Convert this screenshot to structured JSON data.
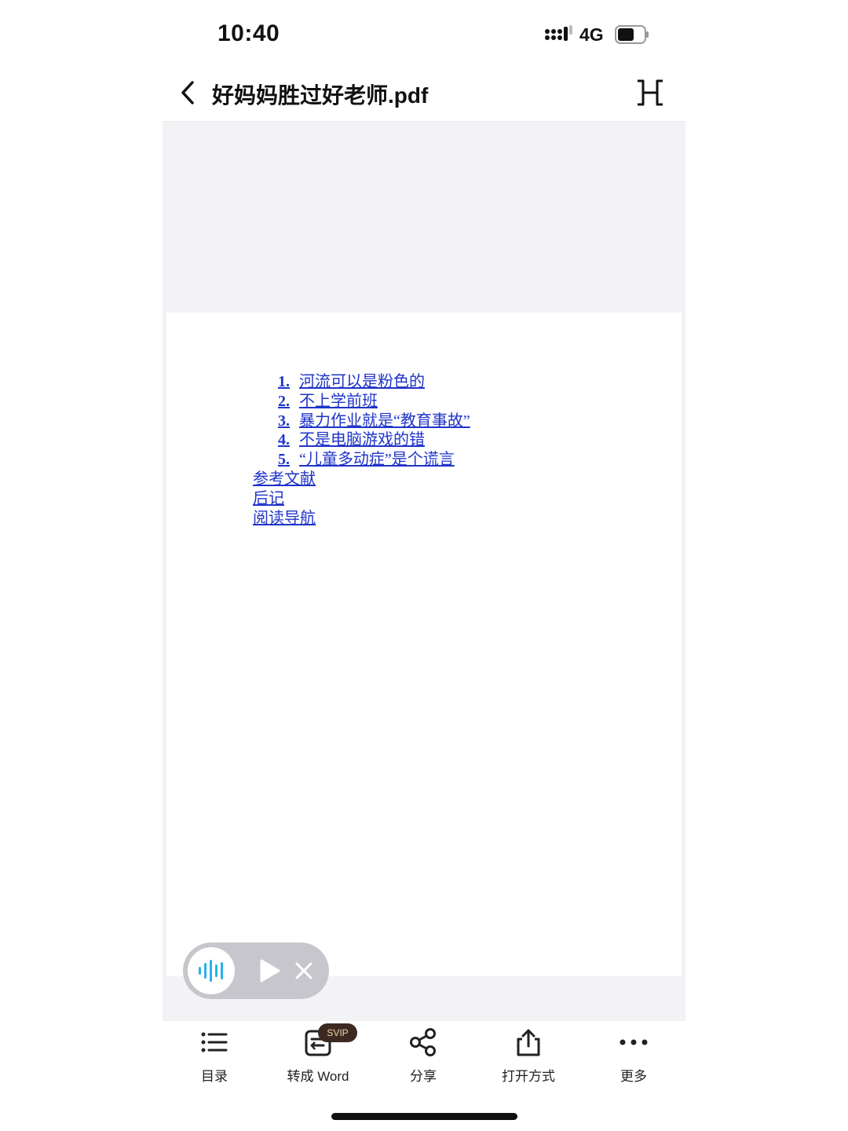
{
  "status_bar": {
    "time": "10:40",
    "network": "4G"
  },
  "header": {
    "title": "好妈妈胜过好老师.pdf"
  },
  "document": {
    "toc": [
      {
        "num": "1.",
        "text": "河流可以是粉色的"
      },
      {
        "num": "2.",
        "text": "不上学前班"
      },
      {
        "num": "3.",
        "text": "暴力作业就是“教育事故”"
      },
      {
        "num": "4.",
        "text": "不是电脑游戏的错"
      },
      {
        "num": "5.",
        "text": "“儿童多动症”是个谎言"
      },
      {
        "text": "参考文献"
      },
      {
        "text": "后记"
      },
      {
        "text": "阅读导航"
      }
    ]
  },
  "toolbar": {
    "toc_label": "目录",
    "convert_label": "转成 Word",
    "convert_badge": "SVIP",
    "share_label": "分享",
    "open_with_label": "打开方式",
    "more_label": "更多"
  },
  "colors": {
    "link": "#1f34c9",
    "tts_accent": "#2ab0e8",
    "badge_bg": "#3c2a22",
    "viewer_bg": "#f3f3f6"
  }
}
